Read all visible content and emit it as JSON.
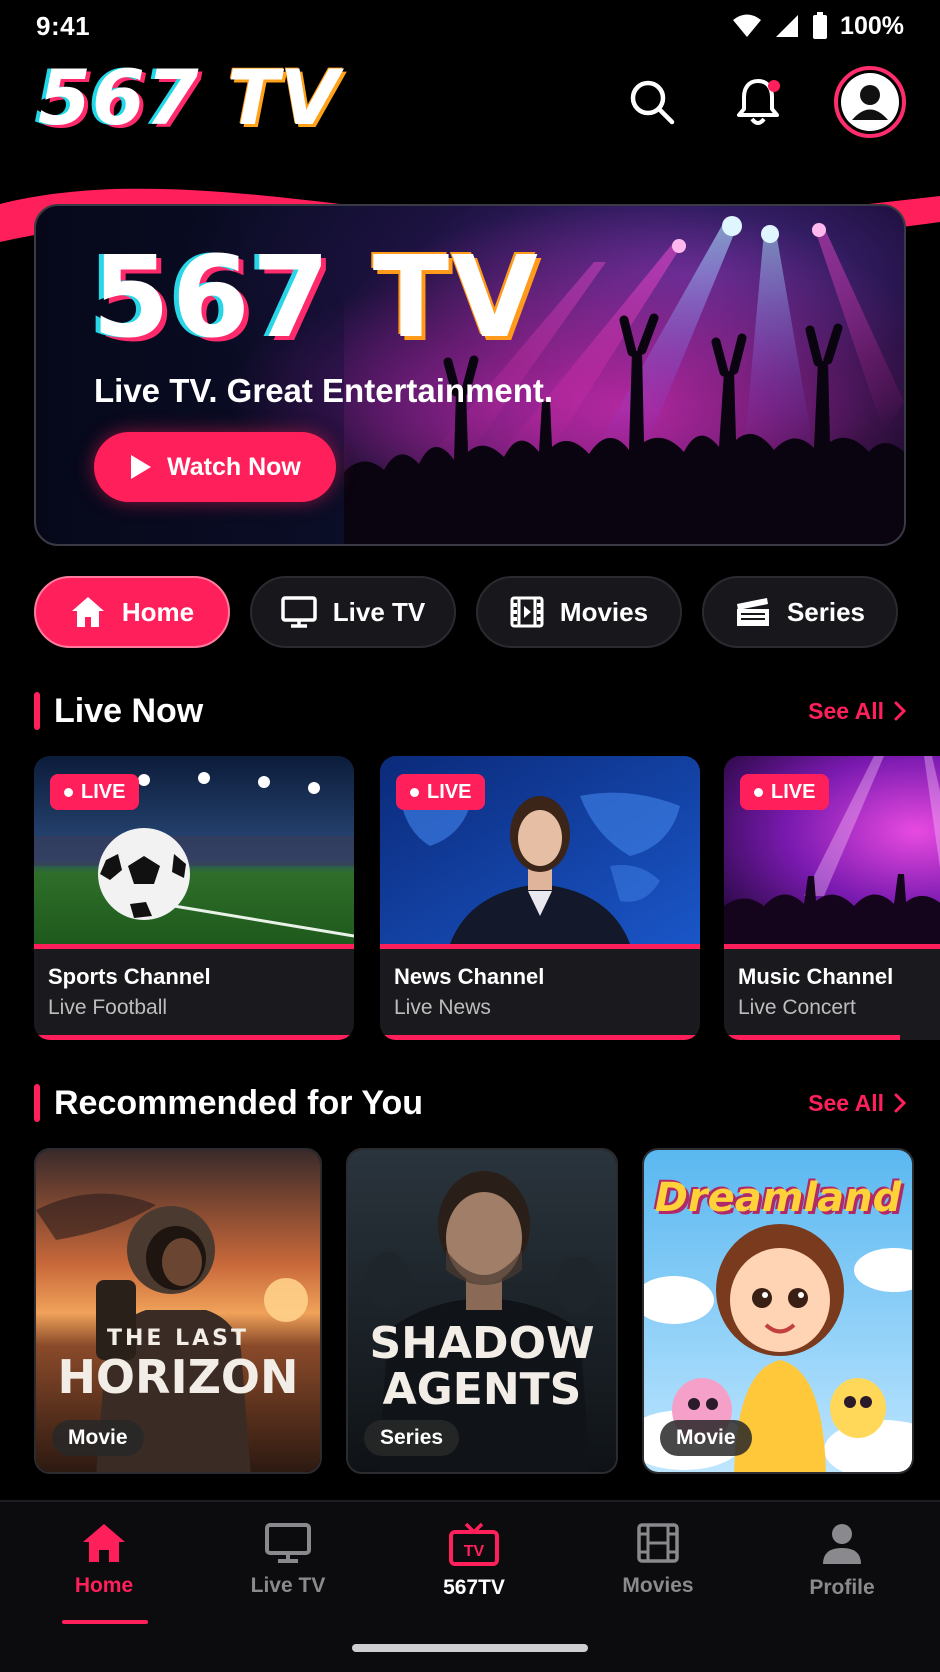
{
  "status_bar": {
    "time": "9:41",
    "battery": "100%"
  },
  "header": {
    "logo_num": "567",
    "logo_tv": "TV"
  },
  "hero": {
    "title_num": "567",
    "title_tv": "TV",
    "subtitle": "Live TV. Great Entertainment.",
    "button_label": "Watch Now"
  },
  "categories": [
    {
      "label": "Home",
      "icon": "home-icon",
      "active": true
    },
    {
      "label": "Live TV",
      "icon": "tv-icon",
      "active": false
    },
    {
      "label": "Movies",
      "icon": "film-icon",
      "active": false
    },
    {
      "label": "Series",
      "icon": "clapperboard-icon",
      "active": false
    }
  ],
  "live_now": {
    "title": "Live Now",
    "see_all": "See All",
    "badge": "LIVE",
    "cards": [
      {
        "name": "Sports Channel",
        "desc": "Live Football",
        "progress": 1.0
      },
      {
        "name": "News Channel",
        "desc": "Live News",
        "progress": 1.0
      },
      {
        "name": "Music Channel",
        "desc": "Live Concert",
        "progress": 0.55
      }
    ]
  },
  "recommended": {
    "title": "Recommended for You",
    "see_all": "See All",
    "cards": [
      {
        "title_small": "THE LAST",
        "title_big": "HORIZON",
        "tag": "Movie"
      },
      {
        "title_big_1": "SHADOW",
        "title_big_2": "AGENTS",
        "tag": "Series"
      },
      {
        "title_big": "Dreamland",
        "tag": "Movie"
      }
    ]
  },
  "bottom_nav": [
    {
      "label": "Home",
      "icon": "home-icon",
      "active": true
    },
    {
      "label": "Live TV",
      "icon": "monitor-icon",
      "active": false
    },
    {
      "label": "567TV",
      "icon": "tv-icon",
      "active": false
    },
    {
      "label": "Movies",
      "icon": "film-icon",
      "active": false
    },
    {
      "label": "Profile",
      "icon": "user-icon",
      "active": false
    }
  ],
  "colors": {
    "accent": "#ff1f5a",
    "background": "#000000",
    "card": "#1a1a1e"
  }
}
